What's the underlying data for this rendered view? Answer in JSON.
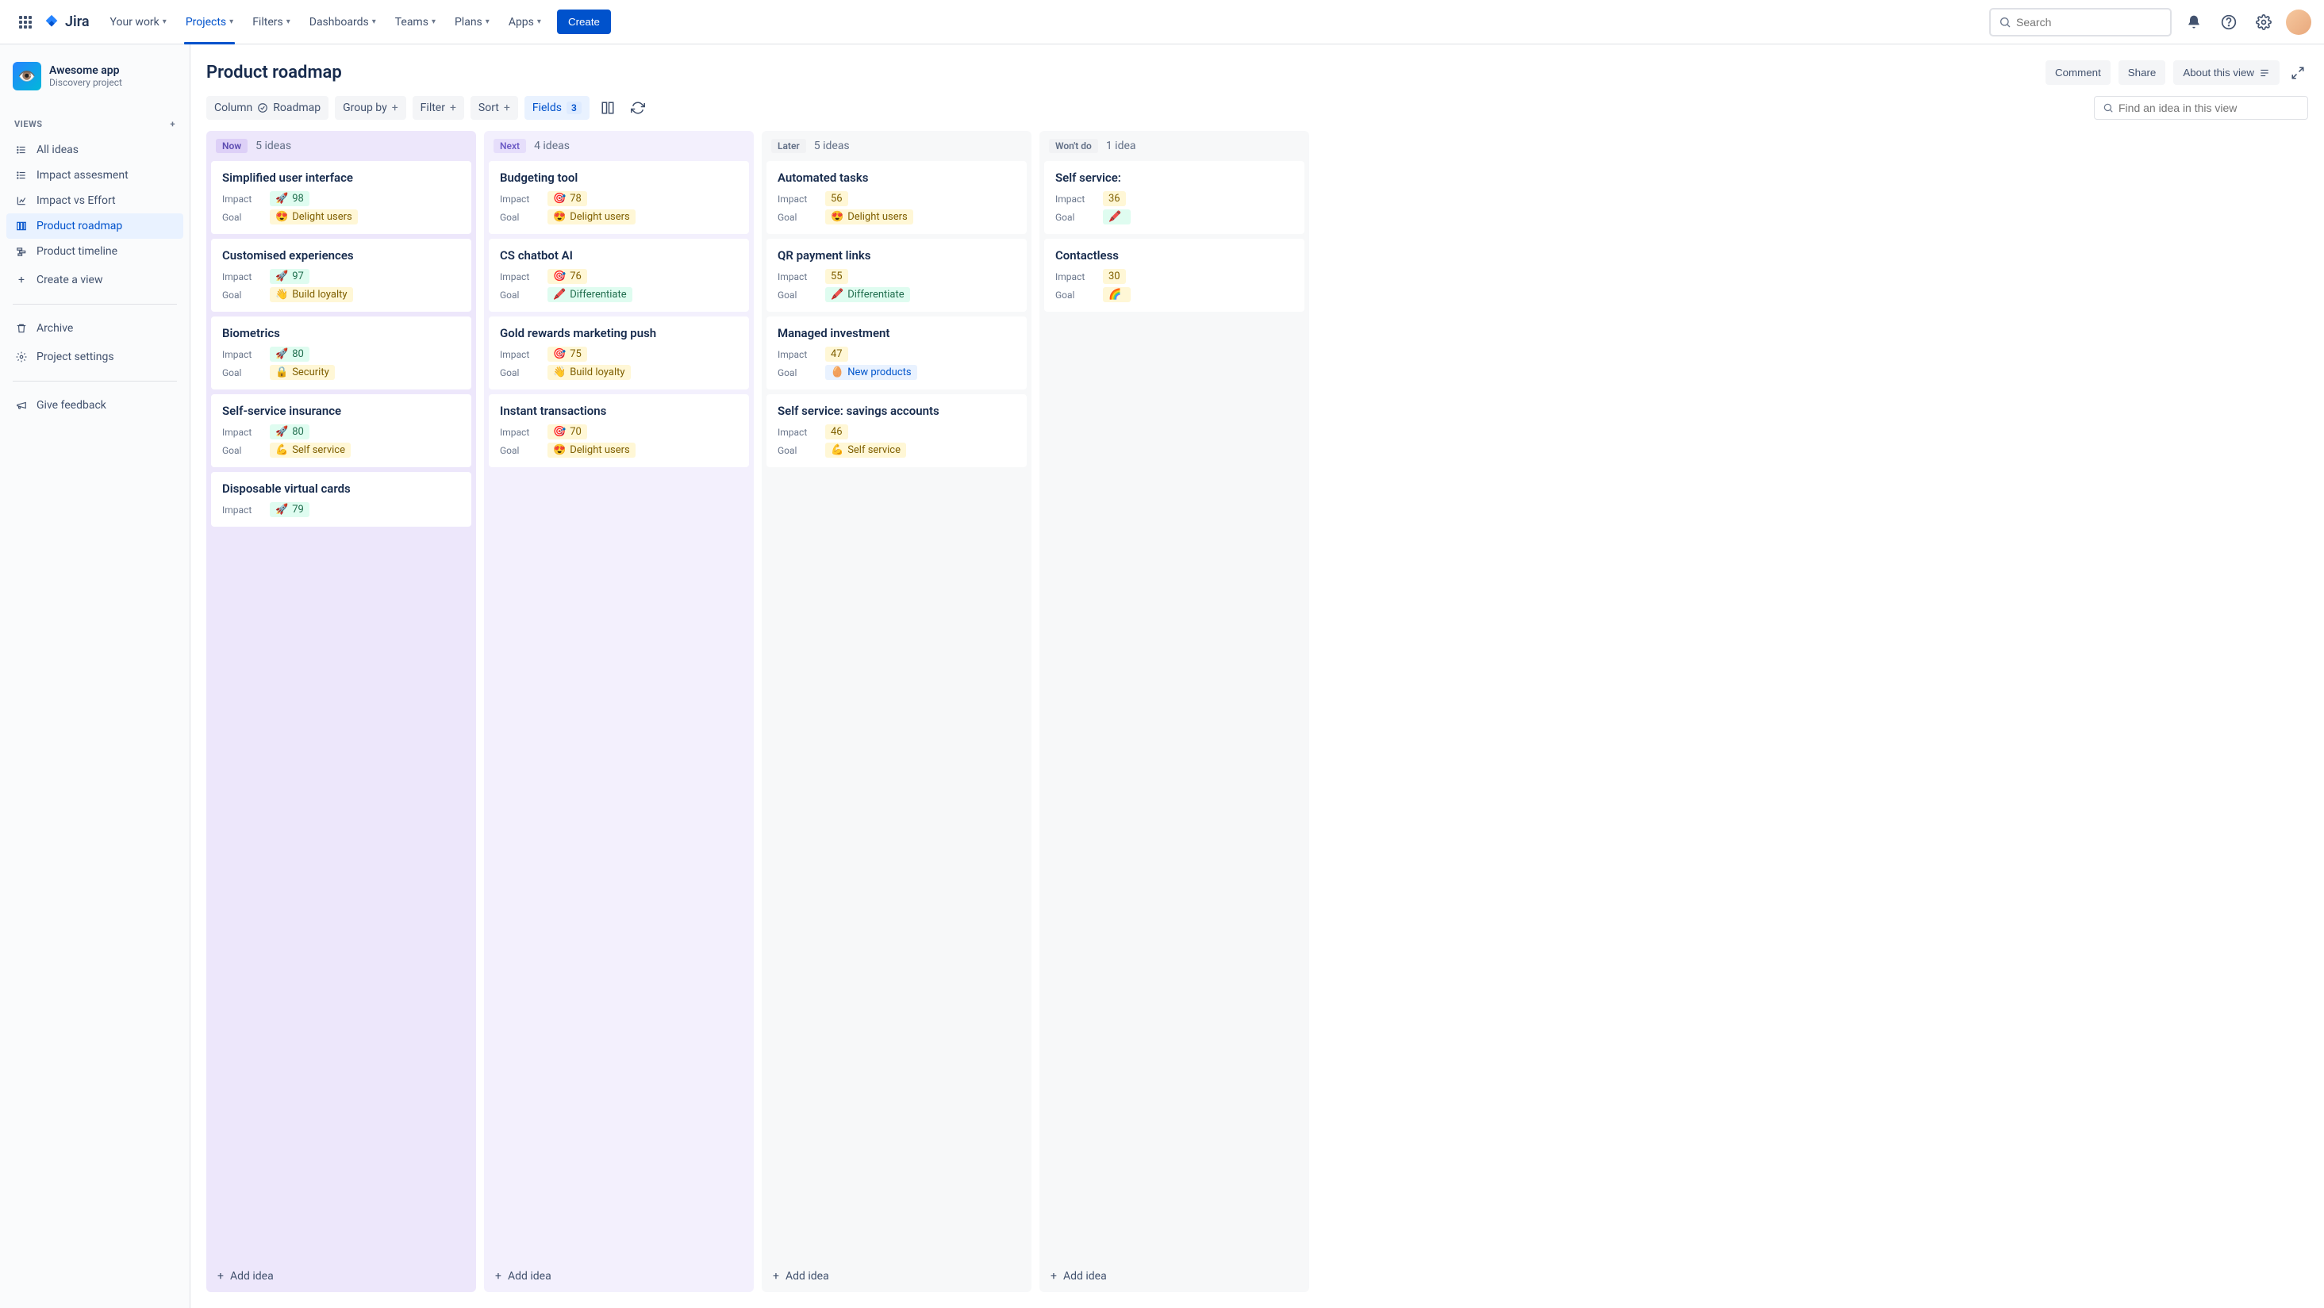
{
  "brand": "Jira",
  "nav": {
    "items": [
      "Your work",
      "Projects",
      "Filters",
      "Dashboards",
      "Teams",
      "Plans",
      "Apps"
    ],
    "activeIndex": 1,
    "create": "Create"
  },
  "search": {
    "placeholder": "Search"
  },
  "project": {
    "name": "Awesome app",
    "subtitle": "Discovery project"
  },
  "sidebar": {
    "views_label": "VIEWS",
    "items": [
      {
        "label": "All ideas",
        "icon": "list"
      },
      {
        "label": "Impact assesment",
        "icon": "list"
      },
      {
        "label": "Impact vs Effort",
        "icon": "chart"
      },
      {
        "label": "Product roadmap",
        "icon": "board",
        "active": true
      },
      {
        "label": "Product timeline",
        "icon": "timeline"
      }
    ],
    "create_view": "Create a view",
    "archive": "Archive",
    "settings": "Project settings",
    "feedback": "Give feedback"
  },
  "page": {
    "title": "Product roadmap",
    "comment": "Comment",
    "share": "Share",
    "about": "About this view"
  },
  "controls": {
    "column": "Column",
    "column_val": "Roadmap",
    "group": "Group by",
    "filter": "Filter",
    "sort": "Sort",
    "fields": "Fields",
    "fields_count": "3",
    "find_placeholder": "Find an idea in this view"
  },
  "field_labels": {
    "impact": "Impact",
    "goal": "Goal"
  },
  "columns": [
    {
      "key": "now",
      "tag": "Now",
      "count": "5 ideas",
      "add": "Add idea",
      "cards": [
        {
          "title": "Simplified user interface",
          "impact": "98",
          "impact_icon": "🚀",
          "impact_color": "green",
          "goal": "Delight users",
          "goal_icon": "😍",
          "goal_color": "yellow"
        },
        {
          "title": "Customised experiences",
          "impact": "97",
          "impact_icon": "🚀",
          "impact_color": "green",
          "goal": "Build loyalty",
          "goal_icon": "👋",
          "goal_color": "yellow"
        },
        {
          "title": "Biometrics",
          "impact": "80",
          "impact_icon": "🚀",
          "impact_color": "green",
          "goal": "Security",
          "goal_icon": "🔒",
          "goal_color": "yellow"
        },
        {
          "title": "Self-service insurance",
          "impact": "80",
          "impact_icon": "🚀",
          "impact_color": "green",
          "goal": "Self service",
          "goal_icon": "💪",
          "goal_color": "yellow"
        },
        {
          "title": "Disposable virtual cards",
          "impact": "79",
          "impact_icon": "🚀",
          "impact_color": "green"
        }
      ]
    },
    {
      "key": "next",
      "tag": "Next",
      "count": "4 ideas",
      "add": "Add idea",
      "cards": [
        {
          "title": "Budgeting tool",
          "impact": "78",
          "impact_icon": "🎯",
          "impact_color": "yellow",
          "goal": "Delight users",
          "goal_icon": "😍",
          "goal_color": "yellow"
        },
        {
          "title": "CS chatbot AI",
          "impact": "76",
          "impact_icon": "🎯",
          "impact_color": "yellow",
          "goal": "Differentiate",
          "goal_icon": "🖍️",
          "goal_color": "greengoal"
        },
        {
          "title": "Gold rewards marketing push",
          "impact": "75",
          "impact_icon": "🎯",
          "impact_color": "yellow",
          "goal": "Build loyalty",
          "goal_icon": "👋",
          "goal_color": "yellow"
        },
        {
          "title": "Instant transactions",
          "impact": "70",
          "impact_icon": "🎯",
          "impact_color": "yellow",
          "goal": "Delight users",
          "goal_icon": "😍",
          "goal_color": "yellow"
        }
      ]
    },
    {
      "key": "later",
      "tag": "Later",
      "count": "5 ideas",
      "add": "Add idea",
      "cards": [
        {
          "title": "Automated tasks",
          "impact": "56",
          "impact_color": "yellow",
          "goal": "Delight users",
          "goal_icon": "😍",
          "goal_color": "yellow"
        },
        {
          "title": "QR payment links",
          "impact": "55",
          "impact_color": "yellow",
          "goal": "Differentiate",
          "goal_icon": "🖍️",
          "goal_color": "greengoal"
        },
        {
          "title": "Managed investment",
          "impact": "47",
          "impact_color": "yellow",
          "goal": "New products",
          "goal_icon": "🥚",
          "goal_color": "blue"
        },
        {
          "title": "Self service: savings accounts",
          "impact": "46",
          "impact_color": "yellow",
          "goal": "Self service",
          "goal_icon": "💪",
          "goal_color": "yellow"
        }
      ]
    },
    {
      "key": "wont",
      "tag": "Won't do",
      "count": "1 idea",
      "add": "Add idea",
      "cards": [
        {
          "title": "Self service:",
          "impact": "36",
          "impact_color": "yellow",
          "goal": "",
          "goal_icon": "🖍️",
          "goal_color": "greengoal"
        },
        {
          "title": "Contactless",
          "impact": "30",
          "impact_color": "yellow",
          "goal": "",
          "goal_icon": "🌈",
          "goal_color": "yellow"
        }
      ]
    }
  ]
}
